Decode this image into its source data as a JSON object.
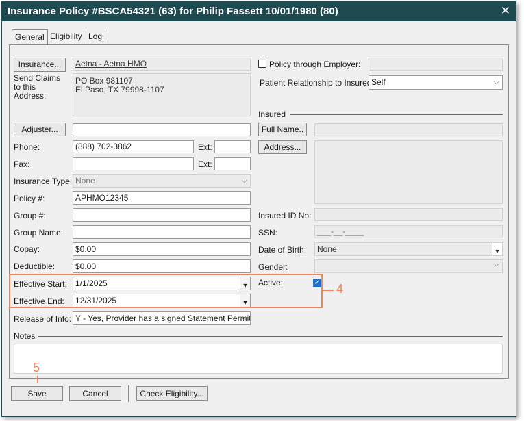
{
  "window": {
    "title": "Insurance Policy #BSCA54321 (63)  for Philip Fassett 10/01/1980 (80)",
    "close": "✕"
  },
  "tabs": [
    "General",
    "Eligibility",
    "Log"
  ],
  "insurance": {
    "button": "Insurance...",
    "name": "Aetna - Aetna HMO",
    "send_claims_label": "Send Claims to this Address:",
    "address_line1": "PO Box 981107",
    "address_line2": "El Paso, TX 79998-1107"
  },
  "employer": {
    "label": "Policy through Employer:",
    "checked": false,
    "value": ""
  },
  "relationship": {
    "label": "Patient Relationship to Insured:",
    "value": "Self"
  },
  "adjuster": {
    "button": "Adjuster...",
    "value": ""
  },
  "phone": {
    "label": "Phone:",
    "value": "(888) 702-3862",
    "ext_label": "Ext:",
    "ext": ""
  },
  "fax": {
    "label": "Fax:",
    "value": "",
    "ext_label": "Ext:",
    "ext": ""
  },
  "insurance_type": {
    "label": "Insurance Type:",
    "value": "None"
  },
  "policy": {
    "label": "Policy #:",
    "value": "APHMO12345"
  },
  "group_no": {
    "label": "Group #:",
    "value": ""
  },
  "group_name": {
    "label": "Group Name:",
    "value": ""
  },
  "copay": {
    "label": "Copay:",
    "value": "$0.00"
  },
  "deductible": {
    "label": "Deductible:",
    "value": "$0.00"
  },
  "effective_start": {
    "label": "Effective Start:",
    "value": "1/1/2025"
  },
  "effective_end": {
    "label": "Effective End:",
    "value": "12/31/2025"
  },
  "release": {
    "label": "Release of Info:",
    "value": "Y - Yes, Provider has a signed Statement Permitting"
  },
  "insured": {
    "section": "Insured",
    "full_name_button": "Full Name..",
    "address_button": "Address...",
    "id_label": "Insured ID No:",
    "ssn_label": "SSN:",
    "ssn_value": "___-__-____",
    "dob_label": "Date of Birth:",
    "dob_value": "None",
    "gender_label": "Gender:",
    "active_label": "Active:",
    "active_checked": true
  },
  "notes": {
    "label": "Notes",
    "value": ""
  },
  "footer": {
    "save": "Save",
    "cancel": "Cancel",
    "check_eligibility": "Check Eligibility..."
  },
  "annotations": {
    "n4": "4",
    "n5": "5"
  },
  "colors": {
    "titlebar": "#1e4a52",
    "annotation": "#f08456",
    "checkbox": "#1d6fd0"
  }
}
